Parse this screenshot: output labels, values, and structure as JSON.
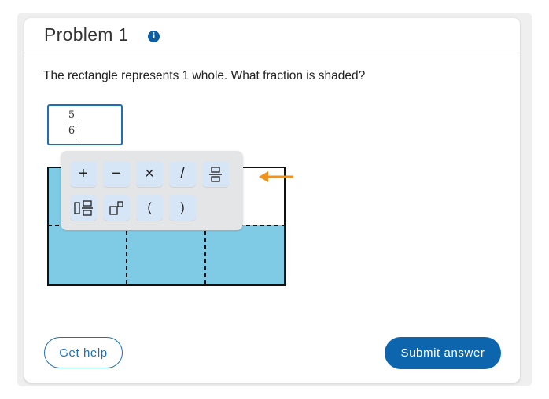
{
  "problem": {
    "title": "Problem 1",
    "info_icon": "i",
    "question": "The rectangle represents 1 whole. What fraction is shaded?"
  },
  "answer": {
    "numerator": "5",
    "denominator": "6"
  },
  "figure": {
    "whole_parts": 6,
    "shaded_parts": 5,
    "shade_color": "#7fcbe6"
  },
  "palette": {
    "keys": [
      {
        "label": "+",
        "name": "plus-key"
      },
      {
        "label": "−",
        "name": "minus-key"
      },
      {
        "label": "×",
        "name": "times-key"
      },
      {
        "label": "/",
        "name": "divide-key"
      },
      {
        "label": "fraction",
        "name": "fraction-key"
      },
      {
        "label": "mixed-number",
        "name": "mixed-number-key"
      },
      {
        "label": "exponent",
        "name": "exponent-key"
      },
      {
        "label": "(",
        "name": "open-paren-key"
      },
      {
        "label": ")",
        "name": "close-paren-key"
      }
    ],
    "highlight_arrow_color": "#f0921e"
  },
  "actions": {
    "help_label": "Get help",
    "submit_label": "Submit answer"
  },
  "colors": {
    "accent": "#1b6fb8",
    "submit_bg": "#0d66ad",
    "key_bg": "#d6e6f6"
  }
}
